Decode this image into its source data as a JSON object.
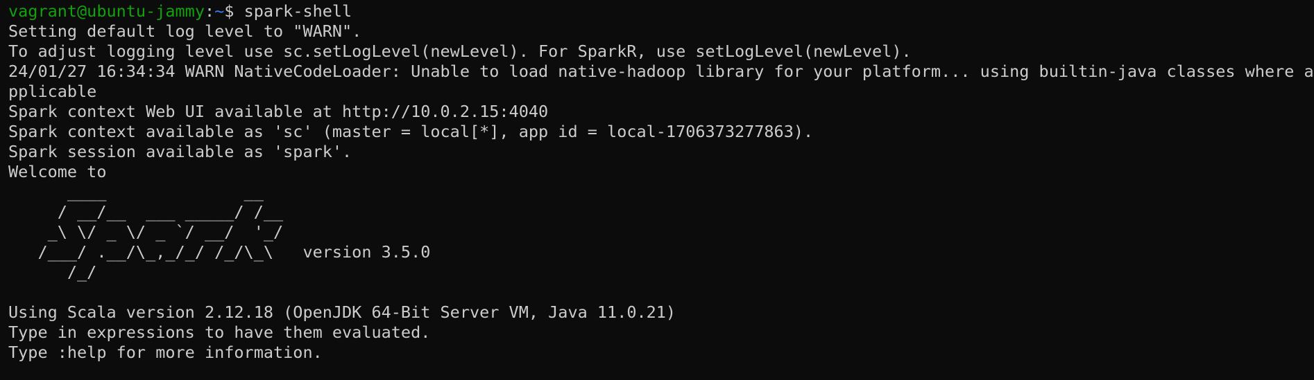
{
  "colors": {
    "background": "#0c0c0c",
    "foreground": "#cccccc",
    "prompt_user": "#13a10e",
    "prompt_path": "#3b78ff"
  },
  "prompt": {
    "user_host": "vagrant@ubuntu-jammy",
    "separator": ":",
    "path": "~",
    "symbol": "$ ",
    "command": "spark-shell"
  },
  "output": {
    "log_level": "Setting default log level to \"WARN\".",
    "adjust_logging": "To adjust logging level use sc.setLogLevel(newLevel). For SparkR, use setLogLevel(newLevel).",
    "warn_line_1": "24/01/27 16:34:34 WARN NativeCodeLoader: Unable to load native-hadoop library for your platform... using builtin-java classes where a",
    "warn_line_2": "pplicable",
    "web_ui": "Spark context Web UI available at http://10.0.2.15:4040",
    "context": "Spark context available as 'sc' (master = local[*], app id = local-1706373277863).",
    "session": "Spark session available as 'spark'.",
    "welcome": "Welcome to",
    "logo_1": "      ____              __",
    "logo_2": "     / __/__  ___ _____/ /__",
    "logo_3": "    _\\ \\/ _ \\/ _ `/ __/  '_/",
    "logo_4": "   /___/ .__/\\_,_/_/ /_/\\_\\   version 3.5.0",
    "logo_5": "      /_/",
    "blank": "",
    "scala_version": "Using Scala version 2.12.18 (OpenJDK 64-Bit Server VM, Java 11.0.21)",
    "type_expr": "Type in expressions to have them evaluated.",
    "type_help": "Type :help for more information."
  }
}
